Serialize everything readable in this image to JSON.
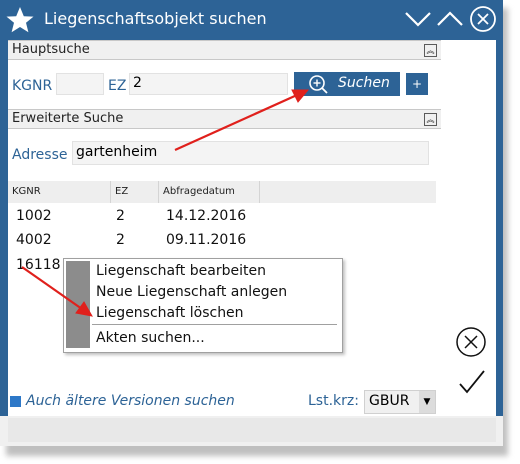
{
  "window": {
    "title": "Liegenschaftsobjekt suchen"
  },
  "titlebar": {
    "icons": [
      "star-icon",
      "minimize-chevron-icon",
      "maximize-chevron-icon",
      "close-icon"
    ]
  },
  "main_search": {
    "header": "Hauptsuche",
    "kgnr_label": "KGNR",
    "kgnr_value": "",
    "ez_label": "EZ",
    "ez_value": "2",
    "search_button": "Suchen",
    "plus_button": "+"
  },
  "advanced_search": {
    "header": "Erweiterte Suche",
    "address_label": "Adresse",
    "address_value": "gartenheim"
  },
  "results": {
    "columns": [
      "KGNR",
      "EZ",
      "Abfragedatum"
    ],
    "rows": [
      {
        "kgnr": "1002",
        "ez": "2",
        "date": "14.12.2016"
      },
      {
        "kgnr": "4002",
        "ez": "2",
        "date": "09.11.2016"
      },
      {
        "kgnr": "16118",
        "ez": "",
        "date": ""
      }
    ]
  },
  "context_menu": {
    "items": [
      "Liegenschaft bearbeiten",
      "Neue Liegenschaft anlegen",
      "Liegenschaft löschen",
      "Akten suchen..."
    ]
  },
  "footer": {
    "older_versions_label": "Auch ältere Versionen suchen",
    "lst_label": "Lst.krz:",
    "lst_value": "GBUR"
  },
  "colors": {
    "brand_blue": "#2d6396",
    "annotation_red": "#e0201c"
  }
}
